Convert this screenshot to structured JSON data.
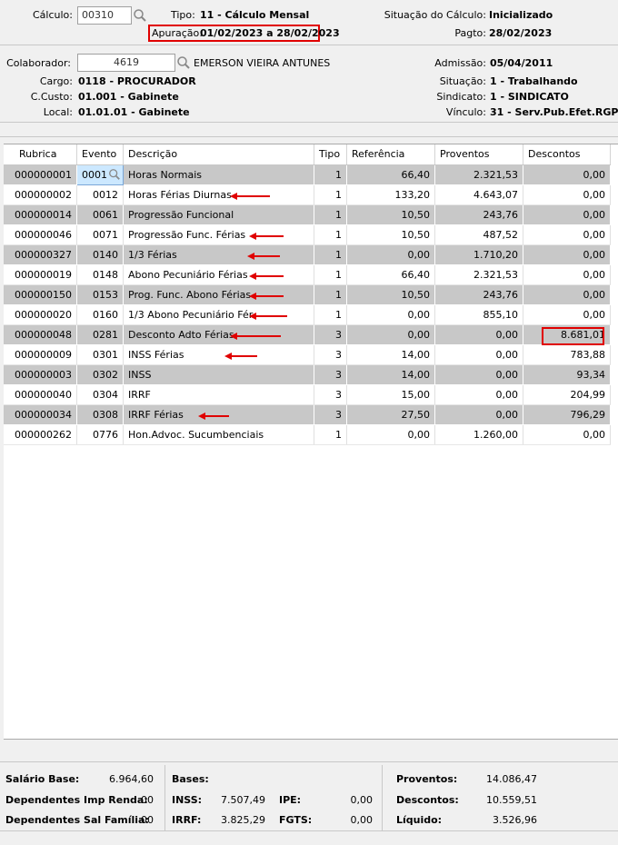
{
  "header": {
    "calculo_label": "Cálculo:",
    "calculo_value": "00310",
    "tipo_label": "Tipo:",
    "tipo_value": "11 - Cálculo Mensal",
    "apuracao_label": "Apuração:",
    "apuracao_value": "01/02/2023 a 28/02/2023",
    "situacao_calc_label": "Situação do Cálculo:",
    "situacao_calc_value": "Inicializado",
    "pagto_label": "Pagto:",
    "pagto_value": "28/02/2023"
  },
  "collaborator": {
    "colaborador_label": "Colaborador:",
    "colaborador_value": "4619",
    "colaborador_name": "EMERSON VIEIRA ANTUNES",
    "cargo_label": "Cargo:",
    "cargo_value": "0118 - PROCURADOR",
    "ccusto_label": "C.Custo:",
    "ccusto_value": "01.001 - Gabinete",
    "local_label": "Local:",
    "local_value": "01.01.01 - Gabinete",
    "admissao_label": "Admissão:",
    "admissao_value": "05/04/2011",
    "situacao_label": "Situação:",
    "situacao_value": "1 - Trabalhando",
    "sindicato_label": "Sindicato:",
    "sindicato_value": "1 - SINDICATO",
    "vinculo_label": "Vínculo:",
    "vinculo_value": "31 - Serv.Pub.Efet.RGPS"
  },
  "table": {
    "columns": [
      "Rubrica",
      "Evento",
      "Descrição",
      "Tipo",
      "Referência",
      "Proventos",
      "Descontos"
    ],
    "rows": [
      [
        "000000001",
        "0001",
        "Horas Normais",
        "1",
        "66,40",
        "2.321,53",
        "0,00"
      ],
      [
        "000000002",
        "0012",
        "Horas Férias Diurnas",
        "1",
        "133,20",
        "4.643,07",
        "0,00"
      ],
      [
        "000000014",
        "0061",
        "Progressão Funcional",
        "1",
        "10,50",
        "243,76",
        "0,00"
      ],
      [
        "000000046",
        "0071",
        "Progressão Func. Férias",
        "1",
        "10,50",
        "487,52",
        "0,00"
      ],
      [
        "000000327",
        "0140",
        "1/3 Férias",
        "1",
        "0,00",
        "1.710,20",
        "0,00"
      ],
      [
        "000000019",
        "0148",
        "Abono Pecuniário Férias",
        "1",
        "66,40",
        "2.321,53",
        "0,00"
      ],
      [
        "000000150",
        "0153",
        "Prog. Func. Abono Férias",
        "1",
        "10,50",
        "243,76",
        "0,00"
      ],
      [
        "000000020",
        "0160",
        "1/3 Abono Pecuniário Fér",
        "1",
        "0,00",
        "855,10",
        "0,00"
      ],
      [
        "000000048",
        "0281",
        "Desconto Adto Férias",
        "3",
        "0,00",
        "0,00",
        "8.681,01"
      ],
      [
        "000000009",
        "0301",
        "INSS Férias",
        "3",
        "14,00",
        "0,00",
        "783,88"
      ],
      [
        "000000003",
        "0302",
        "INSS",
        "3",
        "14,00",
        "0,00",
        "93,34"
      ],
      [
        "000000040",
        "0304",
        "IRRF",
        "3",
        "15,00",
        "0,00",
        "204,99"
      ],
      [
        "000000034",
        "0308",
        "IRRF Férias",
        "3",
        "27,50",
        "0,00",
        "796,29"
      ],
      [
        "000000262",
        "0776",
        "Hon.Advoc. Sucumbenciais",
        "1",
        "0,00",
        "1.260,00",
        "0,00"
      ]
    ]
  },
  "footer": {
    "salario_base_label": "Salário Base:",
    "salario_base_value": "6.964,60",
    "dep_ir_label": "Dependentes Imp Renda:",
    "dep_ir_value": "00",
    "dep_sf_label": "Dependentes Sal Família:",
    "dep_sf_value": "00",
    "bases_label": "Bases:",
    "inss_label": "INSS:",
    "inss_value": "7.507,49",
    "ipe_label": "IPE:",
    "ipe_value": "0,00",
    "irrf_label": "IRRF:",
    "irrf_value": "3.825,29",
    "fgts_label": "FGTS:",
    "fgts_value": "0,00",
    "proventos_label": "Proventos:",
    "proventos_value": "14.086,47",
    "descontos_label": "Descontos:",
    "descontos_value": "10.559,51",
    "liquido_label": "Líquido:",
    "liquido_value": "3.526,96"
  },
  "colors": {
    "annotation": "#e00000",
    "row_alt": "#c8c8c8",
    "selected_cell": "#cce8ff"
  },
  "icons": {
    "search": "search-icon",
    "row_pointer": "row-pointer-icon"
  }
}
